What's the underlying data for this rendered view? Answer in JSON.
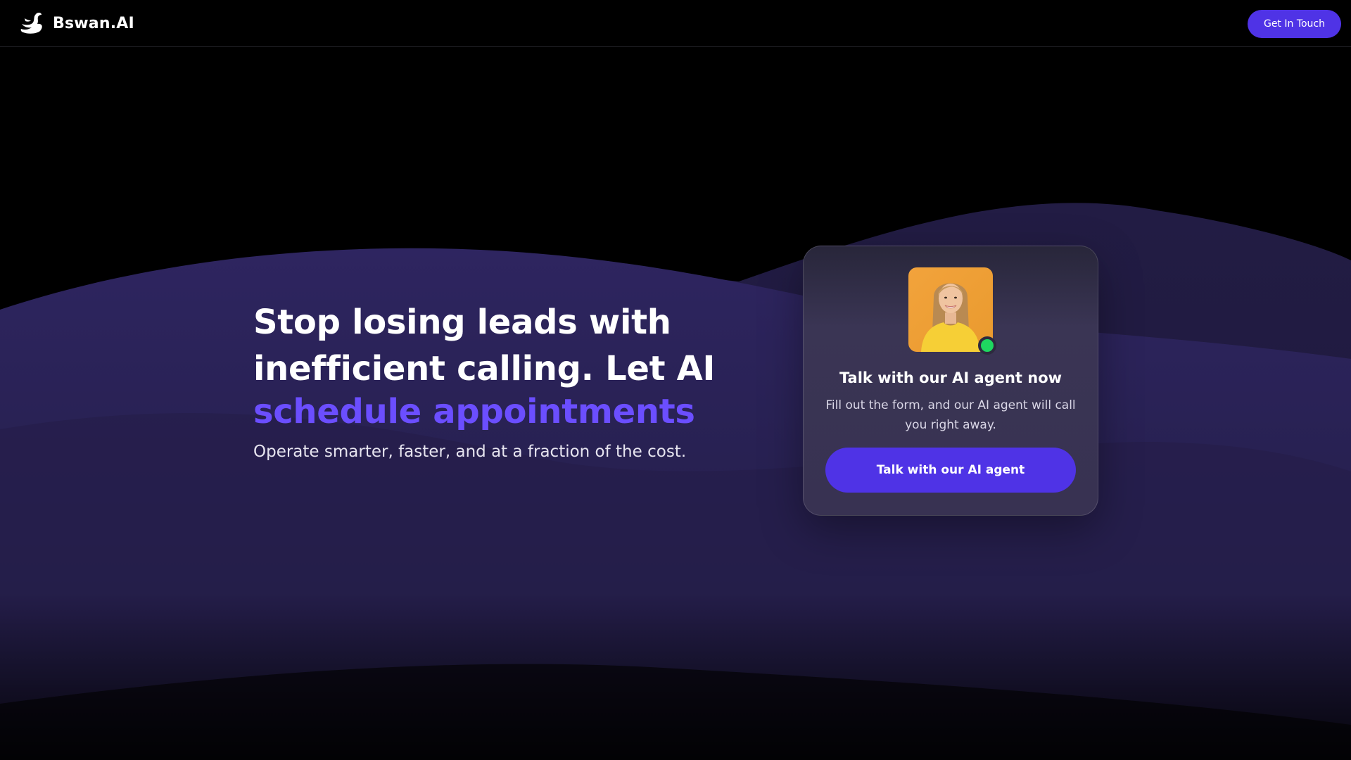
{
  "header": {
    "brand": "Bswan.AI",
    "logo_icon": "swan-icon",
    "cta_label": "Get In Touch"
  },
  "hero": {
    "title_line1": "Stop losing leads with",
    "title_line2": "inefficient calling. Let AI",
    "title_accent": "schedule appointments",
    "subtitle": "Operate smarter, faster, and at a fraction of the cost."
  },
  "card": {
    "avatar_icon": "agent-avatar",
    "status": "online",
    "title": "Talk with our AI agent now",
    "description": "Fill out the form, and our AI agent will call you right away.",
    "button_label": "Talk with our AI agent"
  },
  "colors": {
    "background": "#000000",
    "accent": "#4f33e6",
    "accent_text": "#6b4eff",
    "wave": "#2a2250",
    "status_online": "#1ed760"
  }
}
